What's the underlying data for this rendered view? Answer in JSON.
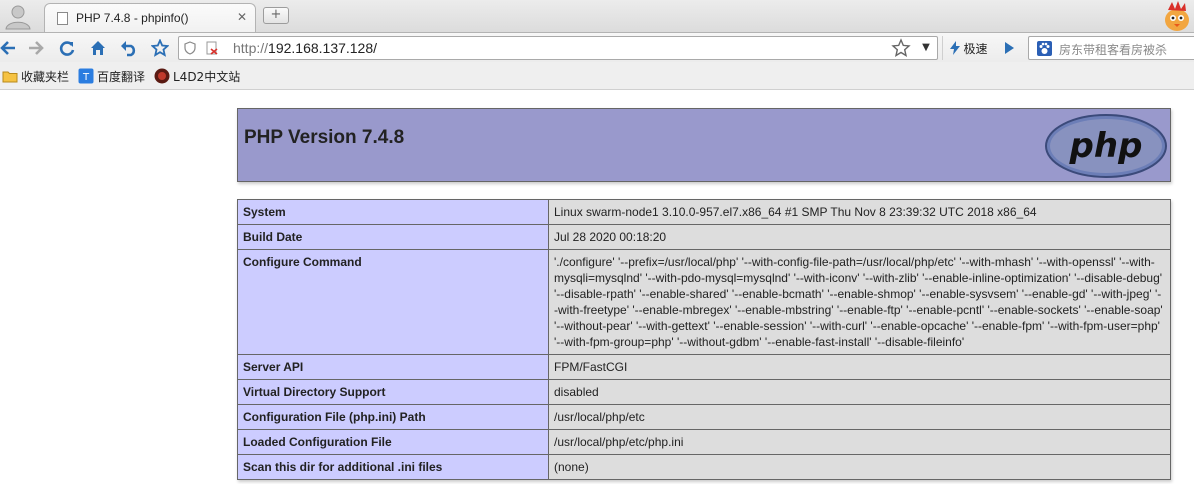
{
  "browser": {
    "tab": {
      "title": "PHP 7.4.8 - phpinfo()",
      "close_glyph": "✕"
    },
    "new_tab_glyph": "+",
    "address": {
      "scheme": "http://",
      "host": "192.168.137.128/"
    },
    "url_dropdown_glyph": "▼",
    "speed_label": "极速",
    "search_placeholder": "房东带租客看房被杀",
    "bookmarks": [
      {
        "label": "收藏夹栏",
        "icon": "folder-icon"
      },
      {
        "label": "百度翻译",
        "icon": "translate-icon"
      },
      {
        "label": "L4D2中文站",
        "icon": "l4d2-site-icon"
      }
    ],
    "colors": {
      "php_header": "#9999cc",
      "key_cell": "#ccccff",
      "value_cell": "#dddddd"
    }
  },
  "phpinfo": {
    "title": "PHP Version 7.4.8",
    "logo_text": "php",
    "rows": [
      {
        "key": "System",
        "value": "Linux swarm-node1 3.10.0-957.el7.x86_64 #1 SMP Thu Nov 8 23:39:32 UTC 2018 x86_64"
      },
      {
        "key": "Build Date",
        "value": "Jul 28 2020 00:18:20"
      },
      {
        "key": "Configure Command",
        "value": "'./configure' '--prefix=/usr/local/php' '--with-config-file-path=/usr/local/php/etc' '--with-mhash' '--with-openssl' '--with-mysqli=mysqlnd' '--with-pdo-mysql=mysqlnd' '--with-iconv' '--with-zlib' '--enable-inline-optimization' '--disable-debug' '--disable-rpath' '--enable-shared' '--enable-bcmath' '--enable-shmop' '--enable-sysvsem' '--enable-gd' '--with-jpeg' '--with-freetype' '--enable-mbregex' '--enable-mbstring' '--enable-ftp' '--enable-pcntl' '--enable-sockets' '--enable-soap' '--without-pear' '--with-gettext' '--enable-session' '--with-curl' '--enable-opcache' '--enable-fpm' '--with-fpm-user=php' '--with-fpm-group=php' '--without-gdbm' '--enable-fast-install' '--disable-fileinfo'"
      },
      {
        "key": "Server API",
        "value": "FPM/FastCGI"
      },
      {
        "key": "Virtual Directory Support",
        "value": "disabled"
      },
      {
        "key": "Configuration File (php.ini) Path",
        "value": "/usr/local/php/etc"
      },
      {
        "key": "Loaded Configuration File",
        "value": "/usr/local/php/etc/php.ini"
      },
      {
        "key": "Scan this dir for additional .ini files",
        "value": "(none)"
      }
    ]
  }
}
